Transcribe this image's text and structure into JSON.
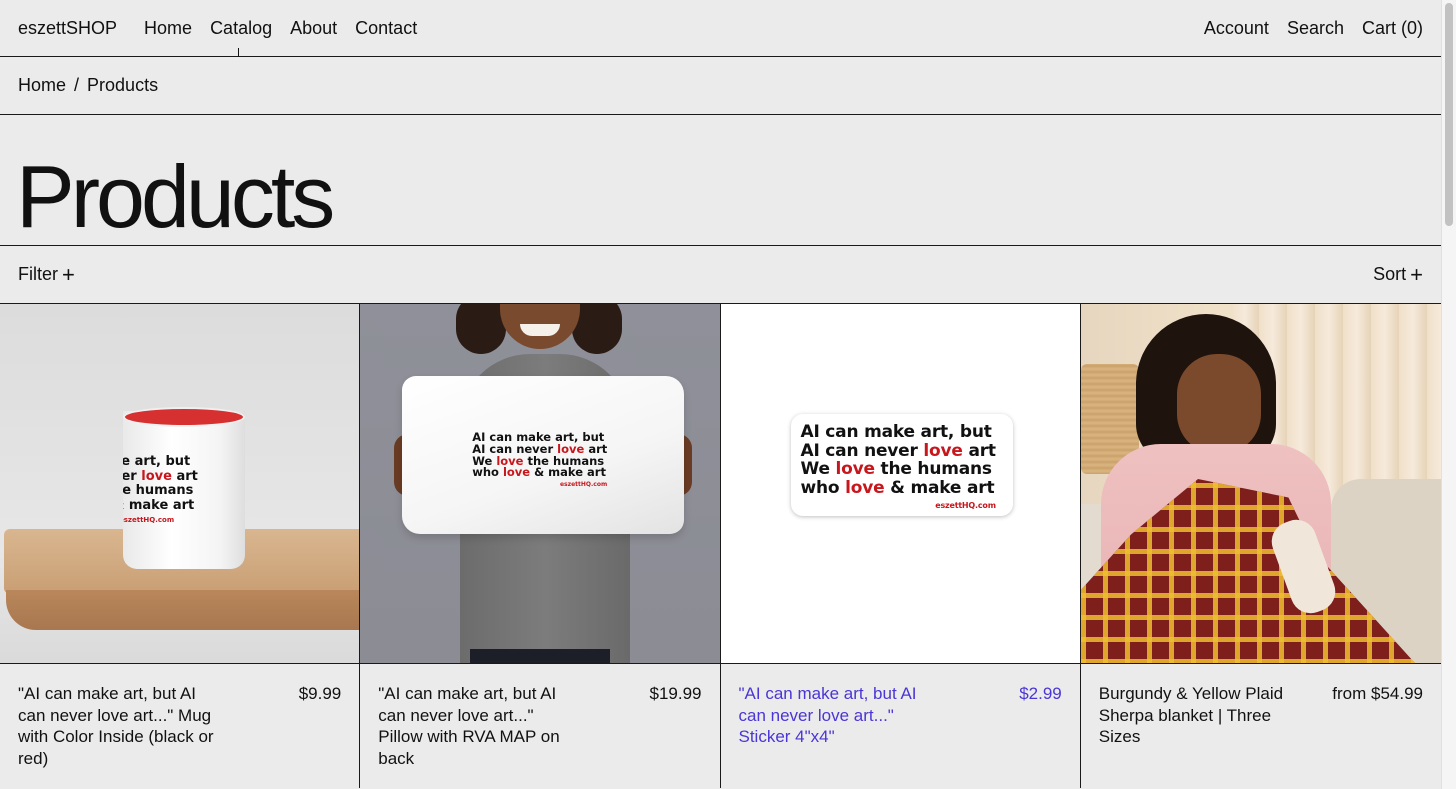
{
  "header": {
    "brand": "eszettSHOP",
    "nav": [
      "Home",
      "Catalog",
      "About",
      "Contact"
    ],
    "utility": [
      "Account",
      "Search",
      "Cart (0)"
    ]
  },
  "breadcrumb": {
    "home": "Home",
    "separator": "/",
    "current": "Products"
  },
  "page": {
    "title": "Products"
  },
  "controls": {
    "filter": "Filter",
    "sort": "Sort",
    "plus": "+"
  },
  "products": [
    {
      "name": "\"AI can make art, but AI can never love art...\" Mug with Color Inside (black or red)",
      "price": "$9.99",
      "image_lines": [
        "ke art, but",
        "ver ",
        "love",
        " art",
        "he humans",
        "& make art"
      ],
      "image_url": "eszettHQ.com"
    },
    {
      "name": "\"AI can make art, but AI can never love art...\" Pillow with RVA MAP on back",
      "price": "$19.99",
      "image_url": "eszettHQ.com"
    },
    {
      "name": "\"AI can make art, but AI can never love art...\" Sticker 4\"x4\"",
      "price": "$2.99",
      "image_url": "eszettHQ.com"
    },
    {
      "name": "Burgundy & Yellow Plaid Sherpa blanket | Three Sizes",
      "price": "from $54.99"
    }
  ],
  "slogan": {
    "l1": "AI can make art, but",
    "l2a": "AI can never ",
    "love": "love",
    "l2b": " art",
    "l3a": "We ",
    "l3b": " the humans",
    "l4a": "who ",
    "l4b": " & make art"
  },
  "colors": {
    "background": "#ebebeb",
    "hover_link": "#4a35d6",
    "slogan_red": "#c8161d"
  }
}
